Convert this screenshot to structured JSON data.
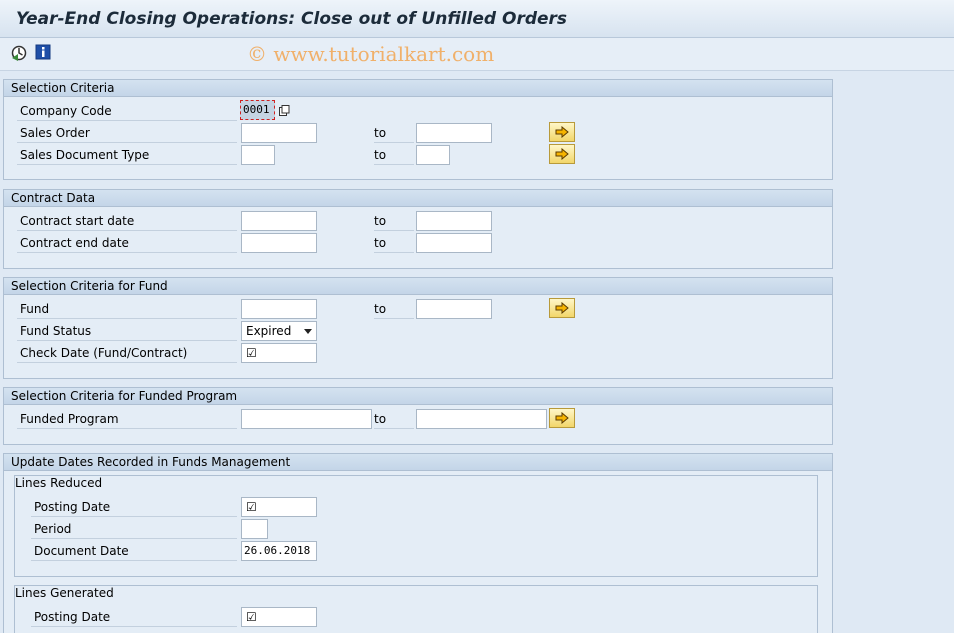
{
  "window": {
    "title": "Year-End Closing Operations: Close out of Unfilled Orders"
  },
  "toolbar": {
    "execute_icon": "execute-icon",
    "info_icon": "info-icon",
    "watermark": "© www.tutorialkart.com"
  },
  "to_label": "to",
  "selection_criteria": {
    "title": "Selection Criteria",
    "company_code": {
      "label": "Company Code",
      "value": "0001"
    },
    "sales_order": {
      "label": "Sales Order",
      "from": "",
      "to": ""
    },
    "sales_doc_type": {
      "label": "Sales Document Type",
      "from": "",
      "to": ""
    }
  },
  "contract_data": {
    "title": "Contract Data",
    "start_date": {
      "label": "Contract start date",
      "from": "",
      "to": ""
    },
    "end_date": {
      "label": "Contract end date",
      "from": "",
      "to": ""
    }
  },
  "fund_criteria": {
    "title": "Selection Criteria for Fund",
    "fund": {
      "label": "Fund",
      "from": "",
      "to": ""
    },
    "fund_status": {
      "label": "Fund Status",
      "value": "Expired"
    },
    "check_date": {
      "label": "Check Date (Fund/Contract)",
      "checked": "☑"
    }
  },
  "funded_program": {
    "title": "Selection Criteria for Funded Program",
    "program": {
      "label": "Funded Program",
      "from": "",
      "to": ""
    }
  },
  "update_dates": {
    "title": "Update Dates Recorded in Funds Management",
    "lines_reduced": {
      "title": "Lines Reduced",
      "posting_date": {
        "label": "Posting Date",
        "checked": "☑"
      },
      "period": {
        "label": "Period",
        "value": ""
      },
      "document_date": {
        "label": "Document Date",
        "value": "26.06.2018"
      }
    },
    "lines_generated": {
      "title": "Lines Generated",
      "posting_date": {
        "label": "Posting Date",
        "checked": "☑"
      }
    }
  }
}
